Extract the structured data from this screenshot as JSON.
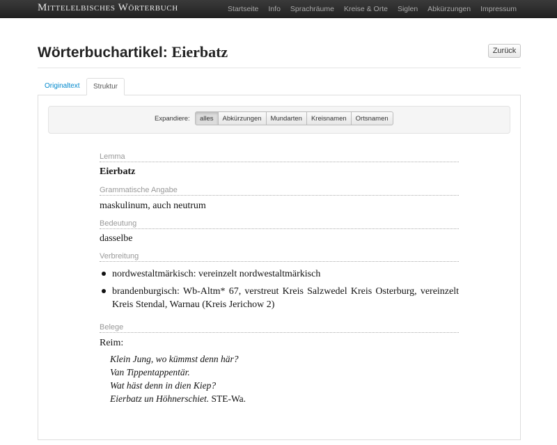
{
  "navbar": {
    "brand": "Mittelelbisches Wörterbuch",
    "links": [
      "Startseite",
      "Info",
      "Sprachräume",
      "Kreise & Orte",
      "Siglen",
      "Abkürzungen",
      "Impressum"
    ]
  },
  "header": {
    "title_prefix": "Wörterbuchartikel: ",
    "title_word": "Eierbatz",
    "back_label": "Zurück"
  },
  "tabs": [
    "Originaltext",
    "Struktur"
  ],
  "active_tab": "Struktur",
  "expand": {
    "label": "Expandiere:",
    "buttons": [
      "alles",
      "Abkürzungen",
      "Mundarten",
      "Kreisnamen",
      "Ortsnamen"
    ]
  },
  "fields": {
    "lemma_label": "Lemma",
    "lemma": "Eierbatz",
    "grammar_label": "Grammatische Angabe",
    "grammar": "maskulinum, auch neutrum",
    "meaning_label": "Bedeutung",
    "meaning": "dasselbe",
    "distribution_label": "Verbreitung",
    "distribution": [
      "nordwestaltmärkisch: vereinzelt nordwestaltmärkisch",
      "brandenburgisch: Wb-Altm* 67, verstreut Kreis Salzwedel Kreis Osterburg, vereinzelt Kreis Stendal, Warnau (Kreis Jerichow 2)"
    ],
    "evidence_label": "Belege",
    "evidence_intro": "Reim:",
    "evidence_lines": [
      "Klein Jung, wo kümmst denn här?",
      "Van Tippentappentär.",
      "Wat häst denn in dien Kiep?",
      "Eierbatz un Höhnerschiet."
    ],
    "evidence_source": " STE-Wa."
  },
  "colors": {
    "navbar": "#222222",
    "link": "#0088cc",
    "label": "#999999"
  }
}
